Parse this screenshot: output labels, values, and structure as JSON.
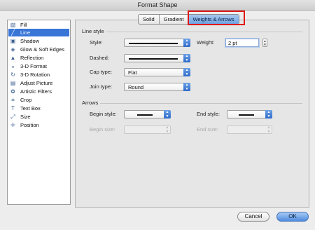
{
  "window": {
    "title": "Format Shape"
  },
  "sidebar": {
    "items": [
      {
        "label": "Fill",
        "icon": "fill-icon",
        "glyph": "▧"
      },
      {
        "label": "Line",
        "icon": "line-icon",
        "glyph": "╱",
        "selected": true
      },
      {
        "label": "Shadow",
        "icon": "shadow-icon",
        "glyph": "▣"
      },
      {
        "label": "Glow & Soft Edges",
        "icon": "glow-icon",
        "glyph": "◈"
      },
      {
        "label": "Reflection",
        "icon": "reflection-icon",
        "glyph": "▲"
      },
      {
        "label": "3-D Format",
        "icon": "3d-format-icon",
        "glyph": "◒"
      },
      {
        "label": "3-D Rotation",
        "icon": "3d-rotation-icon",
        "glyph": "↻"
      },
      {
        "label": "Adjust Picture",
        "icon": "adjust-picture-icon",
        "glyph": "▤"
      },
      {
        "label": "Artistic Filters",
        "icon": "artistic-filters-icon",
        "glyph": "✿"
      },
      {
        "label": "Crop",
        "icon": "crop-icon",
        "glyph": "⌗"
      },
      {
        "label": "Text Box",
        "icon": "text-box-icon",
        "glyph": "T"
      },
      {
        "label": "Size",
        "icon": "size-icon",
        "glyph": "⤢"
      },
      {
        "label": "Position",
        "icon": "position-icon",
        "glyph": "✛"
      }
    ]
  },
  "tabs": [
    {
      "label": "Solid"
    },
    {
      "label": "Gradient"
    },
    {
      "label": "Weights & Arrows",
      "active": true
    }
  ],
  "line_style": {
    "section_label": "Line style",
    "style_label": "Style:",
    "weight_label": "Weight:",
    "weight_value": "2 pt",
    "dashed_label": "Dashed:",
    "cap_label": "Cap type:",
    "cap_value": "Flat",
    "join_label": "Join type:",
    "join_value": "Round"
  },
  "arrows": {
    "section_label": "Arrows",
    "begin_style_label": "Begin style:",
    "end_style_label": "End style:",
    "begin_size_label": "Begin size:",
    "end_size_label": "End size:"
  },
  "buttons": {
    "cancel": "Cancel",
    "ok": "OK"
  }
}
